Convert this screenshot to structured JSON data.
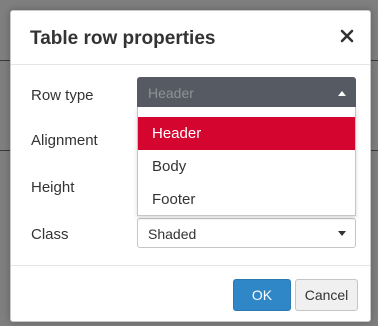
{
  "dialog": {
    "title": "Table row properties",
    "close_icon": "close-icon"
  },
  "form": {
    "row_type": {
      "label": "Row type",
      "value": "Header",
      "options": [
        "Header",
        "Body",
        "Footer"
      ],
      "selected_option": "Header"
    },
    "alignment": {
      "label": "Alignment"
    },
    "height": {
      "label": "Height"
    },
    "class": {
      "label": "Class",
      "value": "Shaded"
    }
  },
  "footer": {
    "ok_label": "OK",
    "cancel_label": "Cancel"
  },
  "colors": {
    "highlight": "#d4062f",
    "ok_button": "#2f87c8",
    "open_select": "#565b63"
  }
}
